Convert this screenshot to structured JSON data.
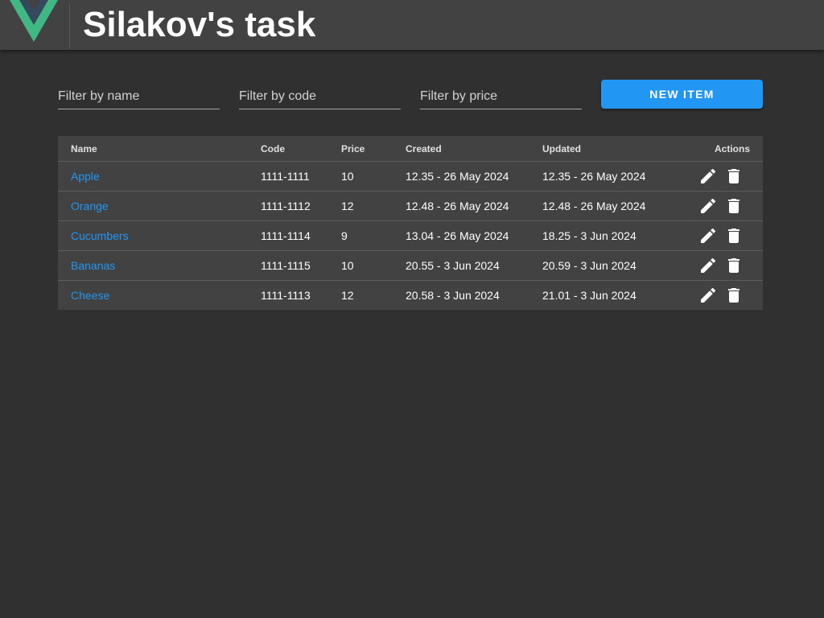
{
  "app": {
    "title": "Silakov's task",
    "logo_icon": "vue-logo-icon",
    "accent_color": "#2196f3",
    "logo_colors": [
      "#41b883",
      "#35495e"
    ]
  },
  "filters": {
    "name_placeholder": "Filter by name",
    "code_placeholder": "Filter by code",
    "price_placeholder": "Filter by price",
    "name_value": "",
    "code_value": "",
    "price_value": ""
  },
  "toolbar": {
    "new_item_label": "New Item"
  },
  "table": {
    "headers": {
      "name": "Name",
      "code": "Code",
      "price": "Price",
      "created": "Created",
      "updated": "Updated",
      "actions": "Actions"
    },
    "action_icons": [
      "pencil-icon",
      "trash-icon"
    ],
    "rows": [
      {
        "name": "Apple",
        "code": "1111-1111",
        "price": "10",
        "created": "12.35 - 26 May 2024",
        "updated": "12.35 - 26 May 2024"
      },
      {
        "name": "Orange",
        "code": "1111-1112",
        "price": "12",
        "created": "12.48 - 26 May 2024",
        "updated": "12.48 - 26 May 2024"
      },
      {
        "name": "Cucumbers",
        "code": "1111-1114",
        "price": "9",
        "created": "13.04 - 26 May 2024",
        "updated": "18.25 - 3 Jun 2024"
      },
      {
        "name": "Bananas",
        "code": "1111-1115",
        "price": "10",
        "created": "20.55 - 3 Jun 2024",
        "updated": "20.59 - 3 Jun 2024"
      },
      {
        "name": "Cheese",
        "code": "1111-1113",
        "price": "12",
        "created": "20.58 - 3 Jun 2024",
        "updated": "21.01 - 3 Jun 2024"
      }
    ]
  }
}
